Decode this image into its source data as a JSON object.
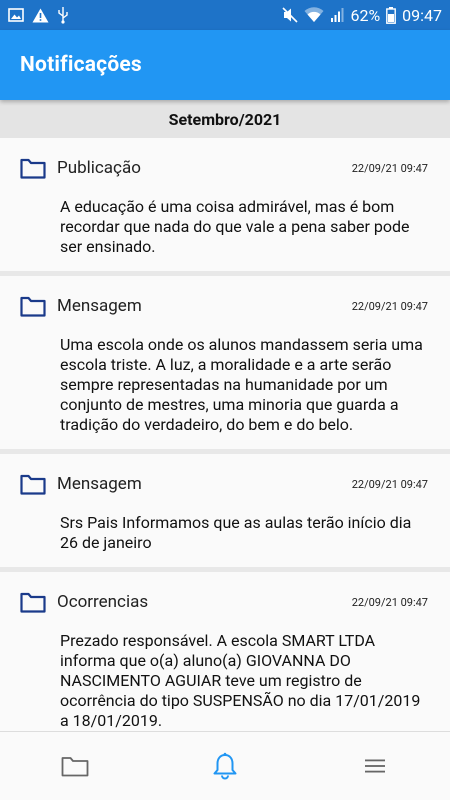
{
  "status_bar": {
    "battery": "62%",
    "time": "09:47",
    "icons": [
      "image-icon",
      "warning-icon",
      "usb-icon",
      "mute-icon",
      "wifi-icon",
      "signal-icon",
      "battery-icon"
    ]
  },
  "appbar": {
    "title": "Notificações"
  },
  "month_header": "Setembro/2021",
  "notifications": [
    {
      "type": "Publicação",
      "date": "22/09/21 09:47",
      "body": "A educação é uma coisa admirável, mas é bom recordar que nada do que vale a pena saber pode ser ensinado."
    },
    {
      "type": "Mensagem",
      "date": "22/09/21 09:47",
      "body": "Uma escola onde os alunos mandassem seria uma escola triste. A luz, a moralidade e a arte serão sempre representadas na humanidade por um conjunto de mestres, uma minoria que guarda a tradição do verdadeiro, do bem e do belo."
    },
    {
      "type": "Mensagem",
      "date": "22/09/21 09:47",
      "body": "Srs Pais Informamos que as aulas terão início dia 26 de janeiro"
    },
    {
      "type": "Ocorrencias",
      "date": "22/09/21 09:47",
      "body": "Prezado responsável. A escola SMART LTDA informa que o(a) aluno(a) GIOVANNA DO NASCIMENTO AGUIAR teve um registro de ocorrência do tipo SUSPENSÃO no dia 17/01/2019 a 18/01/2019."
    }
  ],
  "bottom_nav": [
    "folder-icon",
    "bell-icon",
    "menu-icon"
  ],
  "colors": {
    "appbar": "#2196f3",
    "statusbar": "#1e73c8",
    "folder": "#1a3a8a",
    "active_nav": "#2196f3",
    "inactive_nav": "#666666"
  }
}
